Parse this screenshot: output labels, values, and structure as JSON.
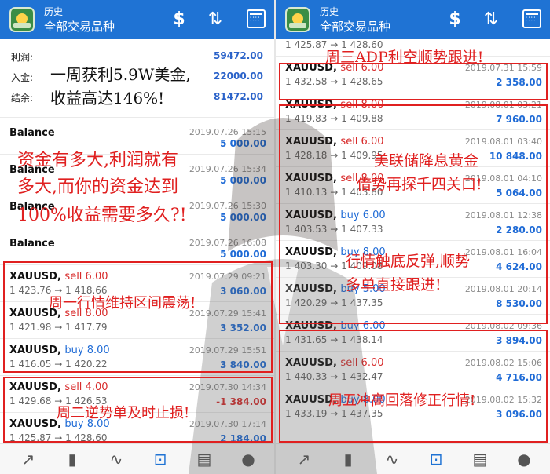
{
  "left": {
    "app_title_small": "历史",
    "app_title": "全部交易品种",
    "summary": [
      {
        "label": "利润:",
        "value": "59472.00"
      },
      {
        "label": "入金:",
        "value": "22000.00"
      },
      {
        "label": "结余:",
        "value": "81472.00"
      }
    ],
    "deals": [
      {
        "symbol": "Balance",
        "side": "",
        "kind": "balance",
        "date": "2019.07.26 15:15",
        "prices": "",
        "pnl": "5 000.00",
        "pnl_sign": "pos"
      },
      {
        "symbol": "Balance",
        "side": "",
        "kind": "balance",
        "date": "2019.07.26 15:34",
        "prices": "",
        "pnl": "5 000.00",
        "pnl_sign": "pos"
      },
      {
        "symbol": "Balance",
        "side": "",
        "kind": "balance",
        "date": "2019.07.26 15:30",
        "prices": "",
        "pnl": "5 000.00",
        "pnl_sign": "pos"
      },
      {
        "symbol": "Balance",
        "side": "",
        "kind": "balance",
        "date": "2019.07.26 16:08",
        "prices": "",
        "pnl": "5 000.00",
        "pnl_sign": "pos"
      },
      {
        "symbol": "XAUUSD, ",
        "side": "sell 6.00",
        "kind": "sell",
        "date": "2019.07.29 09:21",
        "prices": "1 423.76 → 1 418.66",
        "pnl": "3 060.00",
        "pnl_sign": "pos"
      },
      {
        "symbol": "XAUUSD, ",
        "side": "sell 8.00",
        "kind": "sell",
        "date": "2019.07.29 15:41",
        "prices": "1 421.98 → 1 417.79",
        "pnl": "3 352.00",
        "pnl_sign": "pos"
      },
      {
        "symbol": "XAUUSD, ",
        "side": "buy 8.00",
        "kind": "buy",
        "date": "2019.07.29 15:51",
        "prices": "1 416.05 → 1 420.22",
        "pnl": "3 840.00",
        "pnl_sign": "pos"
      },
      {
        "symbol": "XAUUSD, ",
        "side": "sell 4.00",
        "kind": "sell",
        "date": "2019.07.30 14:34",
        "prices": "1 429.68 → 1 426.53",
        "pnl": "-1 384.00",
        "pnl_sign": "neg"
      },
      {
        "symbol": "XAUUSD, ",
        "side": "buy 8.00",
        "kind": "buy",
        "date": "2019.07.30 17:14",
        "prices": "1 425.87 → 1 428.60",
        "pnl": "2 184.00",
        "pnl_sign": "pos"
      }
    ],
    "overlays": {
      "headline": "一周获利5.9W美金,",
      "headline2": "收益高达146%!",
      "question1": "资金有多大,利润就有",
      "question2": "多大,而你的资金达到",
      "question3": "100%收益需要多久?!",
      "monday": "周一行情维持区间震荡!",
      "tuesday": "周二逆势单及时止损!"
    }
  },
  "right": {
    "app_title_small": "历史",
    "app_title": "全部交易品种",
    "deals": [
      {
        "symbol": "XAUUSD, ",
        "side": "buy 8.00",
        "kind": "buy",
        "date": "2019.07.30 17:14",
        "prices": "1 425.87 → 1 428.60",
        "pnl": "",
        "pnl_sign": "pos",
        "partial": true
      },
      {
        "symbol": "XAUUSD, ",
        "side": "sell 6.00",
        "kind": "sell",
        "date": "2019.07.31 15:59",
        "prices": "1 432.58 → 1 428.65",
        "pnl": "2 358.00",
        "pnl_sign": "pos"
      },
      {
        "symbol": "XAUUSD, ",
        "side": "sell 8.00",
        "kind": "sell",
        "date": "2019.08.01 03:21",
        "prices": "1 419.83 → 1 409.88",
        "pnl": "7 960.00",
        "pnl_sign": "pos"
      },
      {
        "symbol": "XAUUSD, ",
        "side": "sell 6.00",
        "kind": "sell",
        "date": "2019.08.01 03:40",
        "prices": "1 428.18 → 1 409.95",
        "pnl": "10 848.00",
        "pnl_sign": "pos"
      },
      {
        "symbol": "XAUUSD, ",
        "side": "sell 8.00",
        "kind": "sell",
        "date": "2019.08.01 04:10",
        "prices": "1 410.13 → 1 403.80",
        "pnl": "5 064.00",
        "pnl_sign": "pos"
      },
      {
        "symbol": "XAUUSD, ",
        "side": "buy 6.00",
        "kind": "buy",
        "date": "2019.08.01 12:38",
        "prices": "1 403.53 → 1 407.33",
        "pnl": "2 280.00",
        "pnl_sign": "pos"
      },
      {
        "symbol": "XAUUSD, ",
        "side": "buy 8.00",
        "kind": "buy",
        "date": "2019.08.01 16:04",
        "prices": "1 403.30 → 1 409.08",
        "pnl": "4 624.00",
        "pnl_sign": "pos"
      },
      {
        "symbol": "XAUUSD, ",
        "side": "buy 5.00",
        "kind": "buy",
        "date": "2019.08.01 20:14",
        "prices": "1 420.29 → 1 437.35",
        "pnl": "8 530.00",
        "pnl_sign": "pos"
      },
      {
        "symbol": "XAUUSD, ",
        "side": "buy 6.00",
        "kind": "buy",
        "date": "2019.08.02 09:36",
        "prices": "1 431.65 → 1 438.14",
        "pnl": "3 894.00",
        "pnl_sign": "pos"
      },
      {
        "symbol": "XAUUSD, ",
        "side": "sell 6.00",
        "kind": "sell",
        "date": "2019.08.02 15:06",
        "prices": "1 440.33 → 1 432.47",
        "pnl": "4 716.00",
        "pnl_sign": "pos"
      },
      {
        "symbol": "XAUUSD, ",
        "side": "buy 8.00",
        "kind": "buy",
        "date": "2019.08.02 15:32",
        "prices": "1 433.19 → 1 437.35",
        "pnl": "3 096.00",
        "pnl_sign": "pos"
      }
    ],
    "overlays": {
      "wednesday": "周三ADP利空顺势跟进!",
      "thursday1": "美联储降息黄金",
      "thursday2": "借势再探千四关口!",
      "rebound1": "行情触底反弹,顺势",
      "rebound2": "多单直接跟进!",
      "friday": "周五冲高回落修正行情!"
    }
  },
  "icons": {
    "dollar": "$",
    "sort": "⇅",
    "nav": [
      "↗",
      "▮",
      "∿",
      "⊡",
      "▤",
      "●"
    ]
  }
}
